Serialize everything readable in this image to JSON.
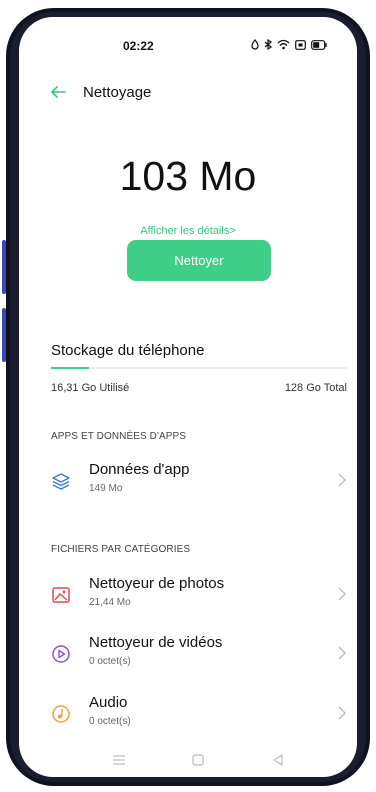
{
  "status": {
    "time": "02:22",
    "icons": [
      "location-icon",
      "bluetooth-icon",
      "wifi-icon",
      "screen-record-icon",
      "battery-icon"
    ]
  },
  "header": {
    "title": "Nettoyage"
  },
  "cleanup": {
    "size": "103 Mo",
    "details_link": "Afficher les détails>",
    "clean_button": "Nettoyer"
  },
  "storage": {
    "title": "Stockage du téléphone",
    "used": "16,31 Go Utilisé",
    "total": "128 Go Total",
    "used_fraction": 0.127
  },
  "apps_section": {
    "label": "APPS ET DONNÉES D'APPS",
    "items": [
      {
        "name": "Données d'app",
        "size": "149 Mo",
        "icon": "layers-icon"
      }
    ]
  },
  "files_section": {
    "label": "FICHIERS PAR CATÉGORIES",
    "items": [
      {
        "name": "Nettoyeur de photos",
        "size": "21,44 Mo",
        "icon": "photo-icon"
      },
      {
        "name": "Nettoyeur de vidéos",
        "size": "0 octet(s)",
        "icon": "video-icon"
      },
      {
        "name": "Audio",
        "size": "0 octet(s)",
        "icon": "audio-icon"
      }
    ]
  },
  "colors": {
    "accent": "#3fce85",
    "accent_text": "#34c77b",
    "photo_icon": "#e0484f",
    "video_icon": "#8a4fe0",
    "audio_icon": "#f0a030",
    "apps_icon": "#3a7bd5"
  }
}
